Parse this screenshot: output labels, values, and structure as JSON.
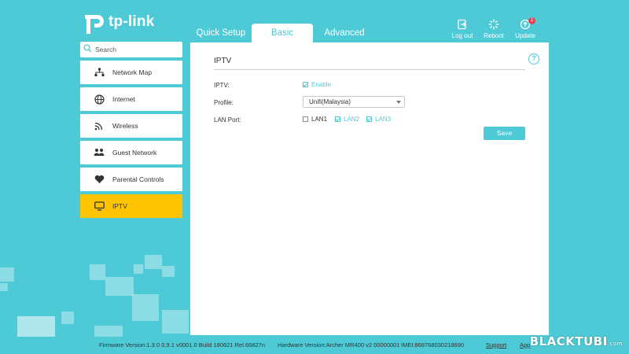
{
  "brand": {
    "name": "tp-link"
  },
  "tabs": [
    {
      "label": "Quick Setup",
      "active": false
    },
    {
      "label": "Basic",
      "active": true
    },
    {
      "label": "Advanced",
      "active": false
    }
  ],
  "actions": {
    "logout": {
      "label": "Log out",
      "icon": "logout-icon"
    },
    "reboot": {
      "label": "Reboot",
      "icon": "reboot-icon"
    },
    "update": {
      "label": "Update",
      "icon": "update-icon",
      "badge": "1"
    }
  },
  "search": {
    "placeholder": "Search"
  },
  "sidebar": {
    "items": [
      {
        "label": "Network Map",
        "icon": "network-map-icon",
        "active": false
      },
      {
        "label": "Internet",
        "icon": "globe-icon",
        "active": false
      },
      {
        "label": "Wireless",
        "icon": "wifi-icon",
        "active": false
      },
      {
        "label": "Guest Network",
        "icon": "guest-icon",
        "active": false
      },
      {
        "label": "Parental Controls",
        "icon": "heart-icon",
        "active": false
      },
      {
        "label": "IPTV",
        "icon": "tv-icon",
        "active": true
      }
    ]
  },
  "panel": {
    "title": "IPTV",
    "iptv": {
      "label": "IPTV:",
      "option": "Enable",
      "checked": true
    },
    "profile": {
      "label": "Profile:",
      "value": "Unifi(Malaysia)"
    },
    "lan_port": {
      "label": "LAN Port:",
      "ports": [
        {
          "label": "LAN1",
          "checked": false
        },
        {
          "label": "LAN2",
          "checked": true
        },
        {
          "label": "LAN3",
          "checked": true
        }
      ]
    },
    "save_label": "Save",
    "help_glyph": "?"
  },
  "footer": {
    "firmware": "Firmware Version:1.3.0 0.9.1 v0001.0 Build 180621 Rel.66827n",
    "hardware": "Hardware Version:Archer MR400 v2 00000001",
    "imei": "IMEI:868768030218690",
    "support": "Support",
    "app": "App"
  },
  "watermark": {
    "text": "BLACKTUBI",
    "suffix": ".com"
  },
  "colors": {
    "background": "#4ecad6",
    "accent": "#4ecad6",
    "active_menu": "#ffc300"
  }
}
